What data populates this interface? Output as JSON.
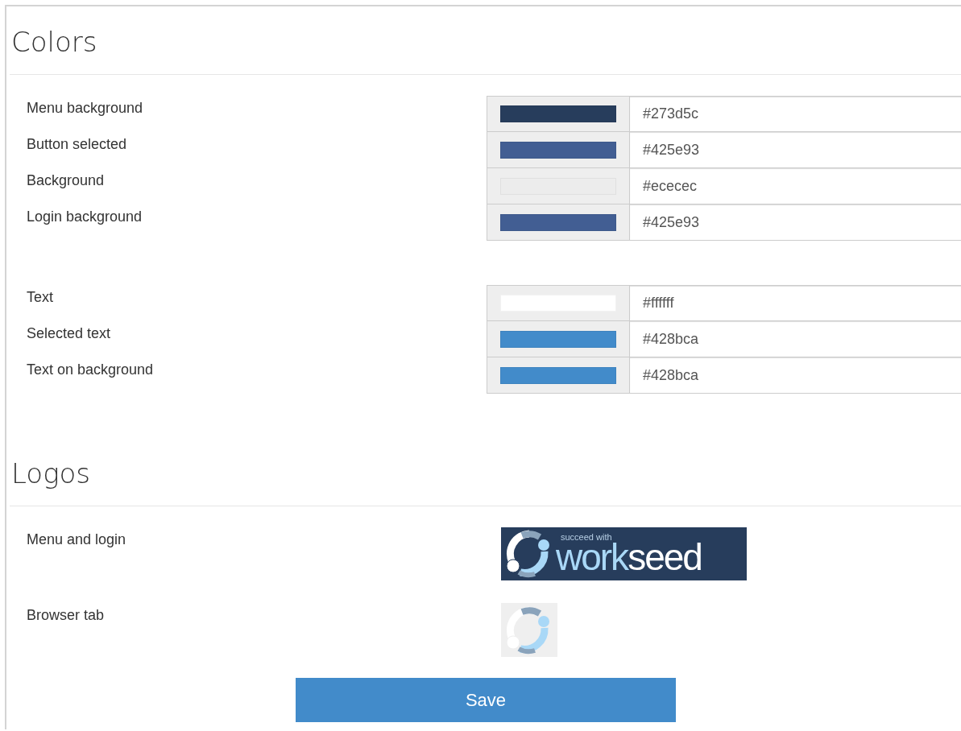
{
  "sections": [
    {
      "kind": "colors",
      "title": "Colors",
      "groups": [
        [
          {
            "label": "Menu background",
            "value": "#273d5c",
            "color": "#273d5c"
          },
          {
            "label": "Button selected",
            "value": "#425e93",
            "color": "#425e93"
          },
          {
            "label": "Background",
            "value": "#ececec",
            "color": "#ececec"
          },
          {
            "label": "Login background",
            "value": "#425e93",
            "color": "#425e93"
          }
        ],
        [
          {
            "label": "Text",
            "value": "#ffffff",
            "color": "#ffffff"
          },
          {
            "label": "Selected text",
            "value": "#428bca",
            "color": "#428bca"
          },
          {
            "label": "Text on background",
            "value": "#428bca",
            "color": "#428bca"
          }
        ]
      ]
    },
    {
      "kind": "logos",
      "title": "Logos",
      "items": [
        {
          "label": "Menu and login",
          "kind": "banner",
          "tagline": "succeed with",
          "wordmark_light": "work",
          "wordmark_bold": "seed"
        },
        {
          "label": "Browser tab",
          "kind": "favicon"
        }
      ]
    }
  ],
  "save_button": "Save"
}
